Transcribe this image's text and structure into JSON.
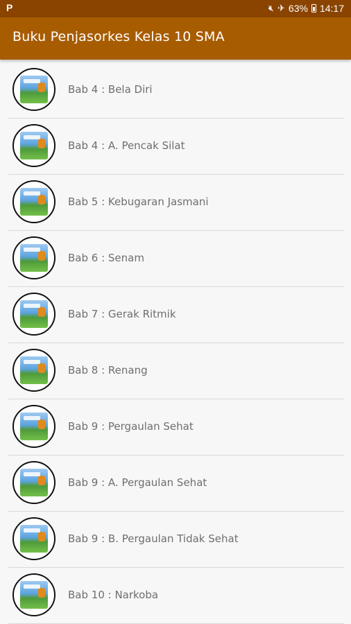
{
  "status_bar": {
    "left_icon": "P",
    "battery": "63%",
    "time": "14:17",
    "icons": [
      "mute-icon",
      "airplane-icon",
      "battery-icon"
    ]
  },
  "app_bar": {
    "title": "Buku Penjasorkes Kelas 10 SMA"
  },
  "items": [
    {
      "label": "Bab 4 : Bela Diri"
    },
    {
      "label": "Bab 4 : A. Pencak Silat"
    },
    {
      "label": "Bab 5 : Kebugaran Jasmani"
    },
    {
      "label": "Bab 6 : Senam"
    },
    {
      "label": "Bab 7 : Gerak Ritmik"
    },
    {
      "label": "Bab 8 : Renang"
    },
    {
      "label": "Bab 9 : Pergaulan Sehat"
    },
    {
      "label": "Bab 9 : A. Pergaulan Sehat"
    },
    {
      "label": "Bab 9 : B. Pergaulan Tidak Sehat"
    },
    {
      "label": "Bab 10 : Narkoba"
    }
  ],
  "colors": {
    "status_bar": "#8a4400",
    "app_bar": "#a85c00",
    "background": "#f7f7f7"
  }
}
